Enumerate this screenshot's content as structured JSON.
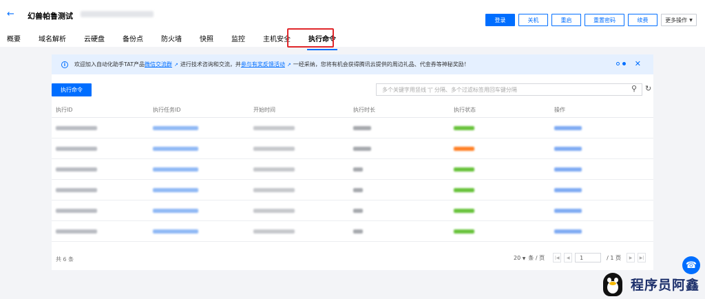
{
  "header": {
    "title": "幻兽帕鲁测试",
    "actions": [
      "登录",
      "关机",
      "重启",
      "重置密码",
      "续费",
      "更多操作"
    ]
  },
  "tabs": [
    "概要",
    "域名解析",
    "云硬盘",
    "备份点",
    "防火墙",
    "快照",
    "监控",
    "主机安全",
    "执行命令"
  ],
  "notice": {
    "prefix": "欢迎加入自动化助手TAT产品",
    "link1": "微信交流群",
    "middle": "进行技术咨询和交流，并",
    "link2": "参与有奖反馈活动",
    "suffix": "一经采纳，您将有机会获得腾讯云提供的周边礼品、代金券等神秘奖励！"
  },
  "toolbar": {
    "run_button": "执行命令",
    "search_placeholder": "多个关键字用竖线 “|” 分隔、多个过滤标签用回车键分隔"
  },
  "table": {
    "columns": [
      "执行ID",
      "执行任务ID",
      "开始时间",
      "执行时长",
      "执行状态",
      "操作"
    ],
    "status_colors": [
      "#67c23a",
      "#ff7f24",
      "#67c23a",
      "#67c23a",
      "#67c23a",
      "#67c23a"
    ]
  },
  "footer": {
    "total": "共 6 条",
    "page_size": "20",
    "page_size_unit": "条 / 页",
    "page": "1",
    "page_total": "/ 1 页"
  },
  "watermark": "程序员阿鑫",
  "colors": {
    "accent": "#006eff",
    "highlight": "#e0262a"
  }
}
